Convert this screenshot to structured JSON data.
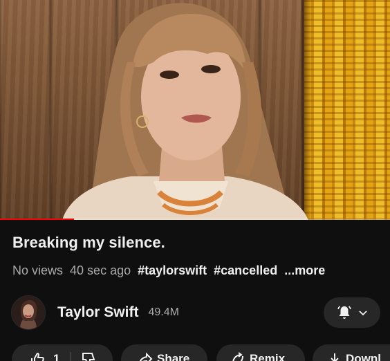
{
  "video": {
    "title": "Breaking my silence.",
    "views": "No views",
    "age": "40 sec ago",
    "hashtags": [
      "#taylorswift",
      "#cancelled"
    ],
    "more": "...more",
    "progress_fraction": 0.19
  },
  "channel": {
    "name": "Taylor Swift",
    "subscribers": "49.4M",
    "avatar_icon": "channel-avatar"
  },
  "subscribe": {
    "bell_icon": "bell-icon",
    "chevron_icon": "chevron-down-icon"
  },
  "actions": {
    "like_count": "1",
    "share_label": "Share",
    "remix_label": "Remix",
    "download_label": "Downl"
  },
  "colors": {
    "background": "#0f0f0f",
    "progress": "#ff0000",
    "pill": "#272727",
    "muted_text": "#aaaaaa"
  }
}
